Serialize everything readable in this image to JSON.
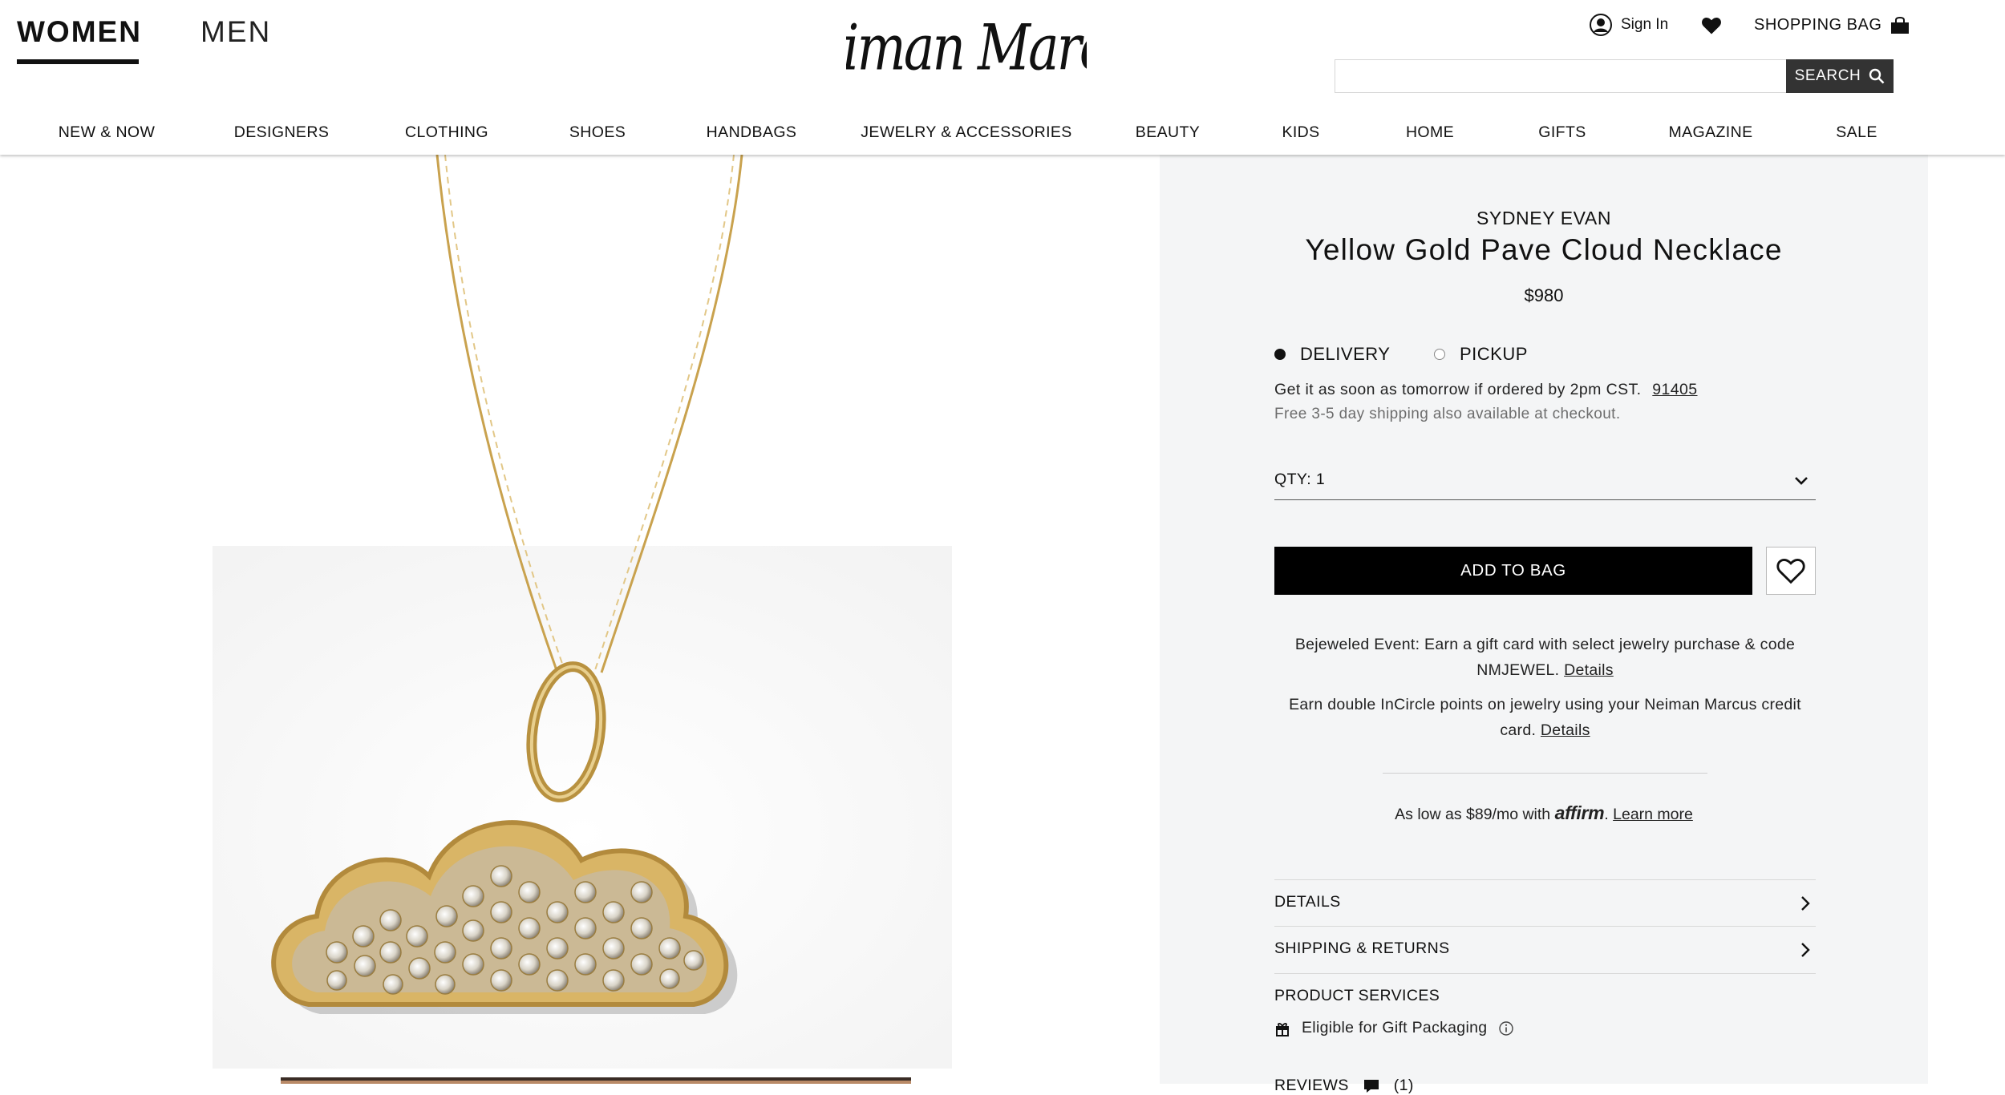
{
  "header": {
    "gender_tabs": [
      {
        "label": "WOMEN",
        "active": true
      },
      {
        "label": "MEN",
        "active": false
      }
    ],
    "logo_text": "Neiman Marcus",
    "sign_in": "Sign In",
    "shopping_bag": "SHOPPING BAG",
    "search": {
      "placeholder": "",
      "button_label": "SEARCH"
    }
  },
  "nav": {
    "items": [
      "NEW & NOW",
      "DESIGNERS",
      "CLOTHING",
      "SHOES",
      "HANDBAGS",
      "JEWELRY & ACCESSORIES",
      "BEAUTY",
      "KIDS",
      "HOME",
      "GIFTS",
      "MAGAZINE",
      "SALE"
    ]
  },
  "product": {
    "designer": "SYDNEY EVAN",
    "title": "Yellow Gold Pave Cloud Necklace",
    "price": "$980",
    "fulfillment": {
      "options": [
        "DELIVERY",
        "PICKUP"
      ],
      "selected": "DELIVERY",
      "delivery_message": "Get it as soon as tomorrow if ordered by 2pm CST.",
      "zip": "91405",
      "shipping_note": "Free 3-5 day shipping also available at checkout."
    },
    "qty_label": "QTY: 1",
    "add_to_bag": "ADD TO BAG",
    "promos": [
      {
        "text": "Bejeweled Event: Earn a gift card with select jewelry purchase & code NMJEWEL.",
        "link": "Details"
      },
      {
        "text": "Earn double InCircle points on jewelry using your Neiman Marcus credit card.",
        "link": "Details"
      }
    ],
    "affirm": {
      "text": "As low as $89/mo with",
      "logo": "affirm",
      "link": "Learn more"
    },
    "accordions": [
      "DETAILS",
      "SHIPPING & RETURNS"
    ],
    "services": {
      "heading": "PRODUCT SERVICES",
      "gift_packaging": "Eligible for Gift Packaging"
    },
    "reviews": {
      "label": "REVIEWS",
      "count": "(1)"
    }
  },
  "colors": {
    "accent": "#000000",
    "panel_bg": "#f4f5f6",
    "search_button": "#333333",
    "gold": "#d8b56a"
  }
}
